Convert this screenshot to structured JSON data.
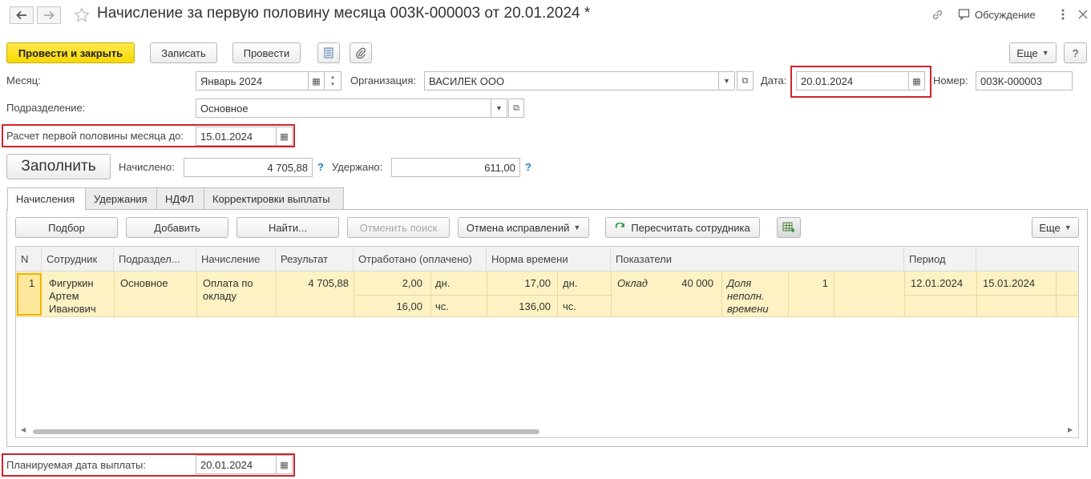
{
  "window": {
    "title": "Начисление за первую половину месяца 003К-000003 от 20.01.2024 *",
    "discuss_label": "Обсуждение"
  },
  "toolbar": {
    "post_close_label": "Провести и закрыть",
    "save_label": "Записать",
    "post_label": "Провести",
    "more_label": "Еще",
    "help_label": "?"
  },
  "form": {
    "month_label": "Месяц:",
    "month_value": "Январь 2024",
    "org_label": "Организация:",
    "org_value": "ВАСИЛЕК ООО",
    "date_label": "Дата:",
    "date_value": "20.01.2024",
    "number_label": "Номер:",
    "number_value": "003К-000003",
    "division_label": "Подразделение:",
    "division_value": "Основное",
    "calc_until_label": "Расчет первой половины месяца до:",
    "calc_until_value": "15.01.2024",
    "fill_label": "Заполнить",
    "accrued_label": "Начислено:",
    "accrued_value": "4 705,88",
    "withheld_label": "Удержано:",
    "withheld_value": "611,00",
    "planned_pay_label": "Планируемая дата выплаты:",
    "planned_pay_value": "20.01.2024"
  },
  "tabs": [
    {
      "label": "Начисления",
      "active": true
    },
    {
      "label": "Удержания",
      "active": false
    },
    {
      "label": "НДФЛ",
      "active": false
    },
    {
      "label": "Корректировки выплаты",
      "active": false
    }
  ],
  "grid_toolbar": {
    "select_label": "Подбор",
    "add_label": "Добавить",
    "find_label": "Найти...",
    "cancel_search_label": "Отменить поиск",
    "cancel_fix_label": "Отмена исправлений",
    "recalc_label": "Пересчитать сотрудника",
    "more_label": "Еще"
  },
  "grid": {
    "columns": [
      "N",
      "Сотрудник",
      "Подраздел...",
      "Начисление",
      "Результат",
      "Отработано (оплачено)",
      "Норма времени",
      "Показатели",
      "Период"
    ],
    "row": {
      "n": "1",
      "employee": [
        "Фигуркин",
        "Артем",
        "Иванович"
      ],
      "division": "Основное",
      "accrual": [
        "Оплата по",
        "окладу"
      ],
      "result": "4 705,88",
      "worked_days": "2,00",
      "worked_days_unit": "дн.",
      "worked_hours": "16,00",
      "worked_hours_unit": "чс.",
      "norm_days": "17,00",
      "norm_days_unit": "дн.",
      "norm_hours": "136,00",
      "norm_hours_unit": "чс.",
      "indicator1_name": "Оклад",
      "indicator1_value": "40 000",
      "indicator2_name": [
        "Доля",
        "неполн.",
        "времени"
      ],
      "indicator2_value": "1",
      "period_start": "12.01.2024",
      "period_end": "15.01.2024"
    }
  },
  "colors": {
    "primary_button": "#f6d900",
    "highlight_box": "#d1232a",
    "selected_row": "#fdf2c3",
    "help_link": "#1f7cc7"
  }
}
